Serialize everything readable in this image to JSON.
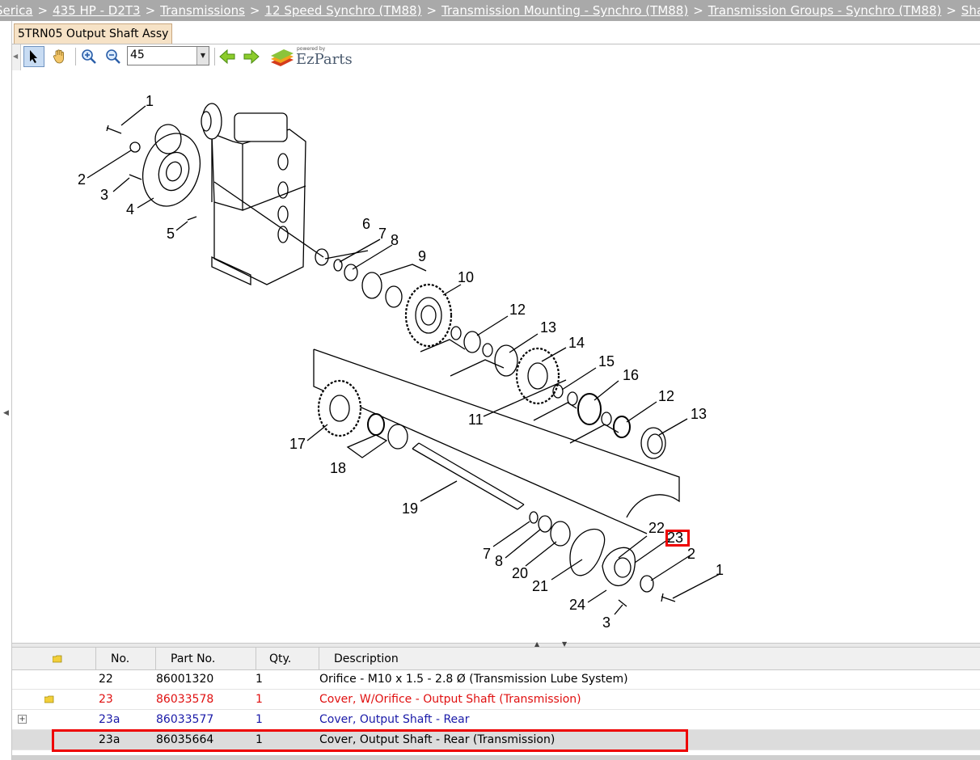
{
  "breadcrumb": [
    {
      "label": "Serica"
    },
    {
      "label": "435 HP - D2T3"
    },
    {
      "label": "Transmissions"
    },
    {
      "label": "12 Speed Synchro (TM88)"
    },
    {
      "label": "Transmission Mounting - Synchro (TM88)"
    },
    {
      "label": "Transmission Groups - Synchro (TM88)"
    },
    {
      "label": "Shaft, Output - S"
    }
  ],
  "breadcrumb_separator": ">",
  "tab": {
    "label": "5TRN05 Output Shaft Assy"
  },
  "toolbar": {
    "zoom_value": "45",
    "tools": [
      "pointer-icon",
      "hand-pan-icon",
      "zoom-in-icon",
      "zoom-out-icon",
      "arrow-left-icon",
      "arrow-right-icon"
    ],
    "logo_text": "EzParts",
    "logo_powered": "powered by"
  },
  "callouts": [
    "1",
    "2",
    "3",
    "4",
    "5",
    "6",
    "7",
    "8",
    "9",
    "10",
    "12",
    "13",
    "14",
    "15",
    "16",
    "11",
    "12",
    "13",
    "17",
    "18",
    "19",
    "22",
    "23",
    "2",
    "1",
    "7",
    "8",
    "20",
    "21",
    "24",
    "3"
  ],
  "grid": {
    "columns": [
      "No.",
      "Part No.",
      "Qty.",
      "Description"
    ],
    "rows": [
      {
        "no": "22",
        "part": "86001320",
        "qty": "1",
        "desc": "Orifice - M10 x 1.5 - 2.8 Ø (Transmission Lube System)",
        "style": "normal",
        "icon": ""
      },
      {
        "no": "23",
        "part": "86033578",
        "qty": "1",
        "desc": "Cover, W/Orifice - Output Shaft (Transmission)",
        "style": "red",
        "icon": "folder-icon"
      },
      {
        "no": "23a",
        "part": "86033577",
        "qty": "1",
        "desc": "Cover, Output Shaft - Rear",
        "style": "blue",
        "icon": "expand-icon"
      },
      {
        "no": "23a",
        "part": "86035664",
        "qty": "1",
        "desc": "Cover, Output Shaft - Rear (Transmission)",
        "style": "selected",
        "icon": ""
      }
    ]
  },
  "colors": {
    "highlight": "#e00000",
    "red_row": "#e01010",
    "blue_row": "#1a1aa8",
    "crumb_bg": "#a9a9a9",
    "tab_bg": "#f6e2c6"
  }
}
